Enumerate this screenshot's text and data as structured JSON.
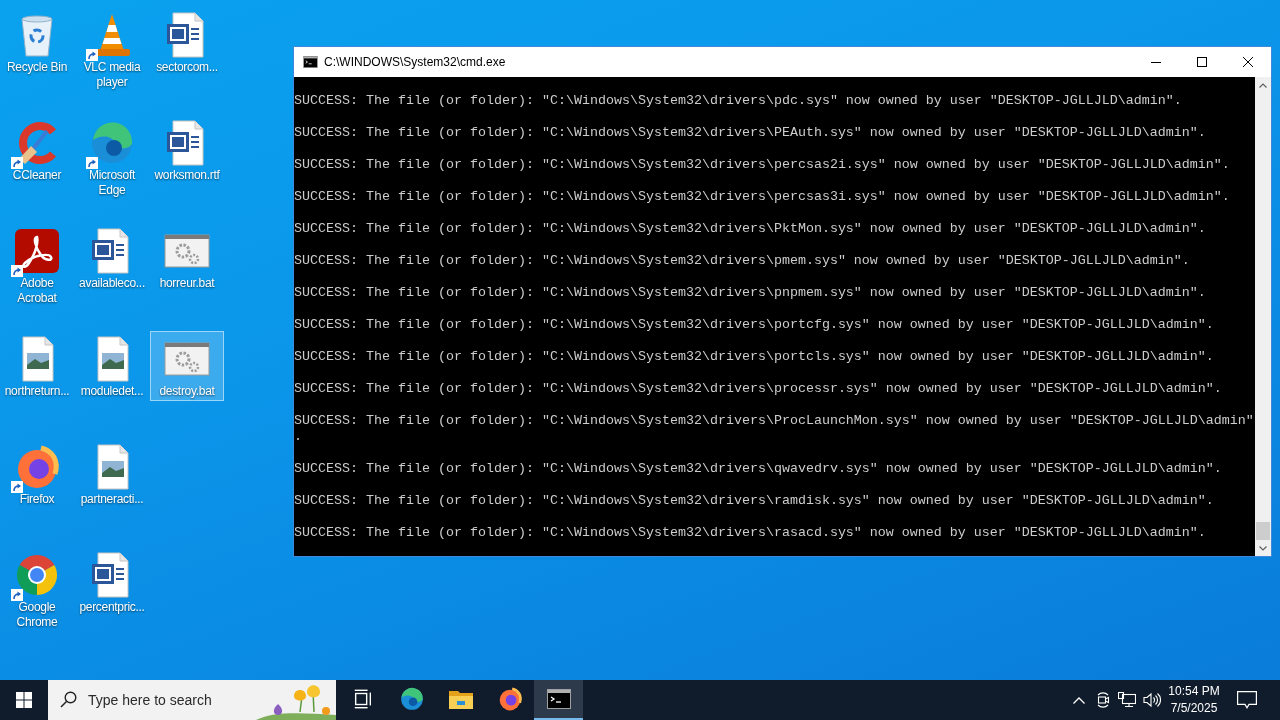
{
  "desktop_icons": [
    {
      "label": "Recycle Bin",
      "kind": "recycle-bin",
      "shortcut": false,
      "selected": false
    },
    {
      "label": "CCleaner",
      "kind": "ccleaner",
      "shortcut": true,
      "selected": false
    },
    {
      "label": "Adobe Acrobat",
      "kind": "acrobat",
      "shortcut": true,
      "selected": false
    },
    {
      "label": "northreturn...",
      "kind": "image",
      "shortcut": false,
      "selected": false
    },
    {
      "label": "Firefox",
      "kind": "firefox",
      "shortcut": true,
      "selected": false
    },
    {
      "label": "Google Chrome",
      "kind": "chrome",
      "shortcut": true,
      "selected": false
    },
    {
      "label": "VLC media player",
      "kind": "vlc",
      "shortcut": true,
      "selected": false
    },
    {
      "label": "Microsoft Edge",
      "kind": "edge",
      "shortcut": true,
      "selected": false
    },
    {
      "label": "availableco...",
      "kind": "word",
      "shortcut": false,
      "selected": false
    },
    {
      "label": "moduledet...",
      "kind": "image",
      "shortcut": false,
      "selected": false
    },
    {
      "label": "partneracti...",
      "kind": "image",
      "shortcut": false,
      "selected": false
    },
    {
      "label": "percentpric...",
      "kind": "word",
      "shortcut": false,
      "selected": false
    },
    {
      "label": "sectorcom...",
      "kind": "word",
      "shortcut": false,
      "selected": false
    },
    {
      "label": "worksmon.rtf",
      "kind": "word",
      "shortcut": false,
      "selected": false
    },
    {
      "label": "horreur.bat",
      "kind": "batch",
      "shortcut": false,
      "selected": false
    },
    {
      "label": "destroy.bat",
      "kind": "batch",
      "shortcut": false,
      "selected": true
    }
  ],
  "console_window": {
    "title": "C:\\WINDOWS\\System32\\cmd.exe",
    "lines": [
      "SUCCESS: The file (or folder): \"C:\\Windows\\System32\\drivers\\pdc.sys\" now owned by user \"DESKTOP-JGLLJLD\\admin\".",
      "SUCCESS: The file (or folder): \"C:\\Windows\\System32\\drivers\\PEAuth.sys\" now owned by user \"DESKTOP-JGLLJLD\\admin\".",
      "SUCCESS: The file (or folder): \"C:\\Windows\\System32\\drivers\\percsas2i.sys\" now owned by user \"DESKTOP-JGLLJLD\\admin\".",
      "SUCCESS: The file (or folder): \"C:\\Windows\\System32\\drivers\\percsas3i.sys\" now owned by user \"DESKTOP-JGLLJLD\\admin\".",
      "SUCCESS: The file (or folder): \"C:\\Windows\\System32\\drivers\\PktMon.sys\" now owned by user \"DESKTOP-JGLLJLD\\admin\".",
      "SUCCESS: The file (or folder): \"C:\\Windows\\System32\\drivers\\pmem.sys\" now owned by user \"DESKTOP-JGLLJLD\\admin\".",
      "SUCCESS: The file (or folder): \"C:\\Windows\\System32\\drivers\\pnpmem.sys\" now owned by user \"DESKTOP-JGLLJLD\\admin\".",
      "SUCCESS: The file (or folder): \"C:\\Windows\\System32\\drivers\\portcfg.sys\" now owned by user \"DESKTOP-JGLLJLD\\admin\".",
      "SUCCESS: The file (or folder): \"C:\\Windows\\System32\\drivers\\portcls.sys\" now owned by user \"DESKTOP-JGLLJLD\\admin\".",
      "SUCCESS: The file (or folder): \"C:\\Windows\\System32\\drivers\\processr.sys\" now owned by user \"DESKTOP-JGLLJLD\\admin\".",
      "SUCCESS: The file (or folder): \"C:\\Windows\\System32\\drivers\\ProcLaunchMon.sys\" now owned by user \"DESKTOP-JGLLJLD\\admin\".",
      "SUCCESS: The file (or folder): \"C:\\Windows\\System32\\drivers\\qwavedrv.sys\" now owned by user \"DESKTOP-JGLLJLD\\admin\".",
      "SUCCESS: The file (or folder): \"C:\\Windows\\System32\\drivers\\ramdisk.sys\" now owned by user \"DESKTOP-JGLLJLD\\admin\".",
      "SUCCESS: The file (or folder): \"C:\\Windows\\System32\\drivers\\rasacd.sys\" now owned by user \"DESKTOP-JGLLJLD\\admin\"."
    ]
  },
  "taskbar": {
    "search": {
      "placeholder": "Type here to search"
    },
    "apps": [
      {
        "kind": "task-view",
        "selected": false
      },
      {
        "kind": "edge",
        "selected": false
      },
      {
        "kind": "file-explorer",
        "selected": false
      },
      {
        "kind": "firefox",
        "selected": false
      },
      {
        "kind": "cmd",
        "selected": true
      }
    ],
    "clock": {
      "time": "10:54 PM",
      "date": "7/5/2025"
    }
  }
}
